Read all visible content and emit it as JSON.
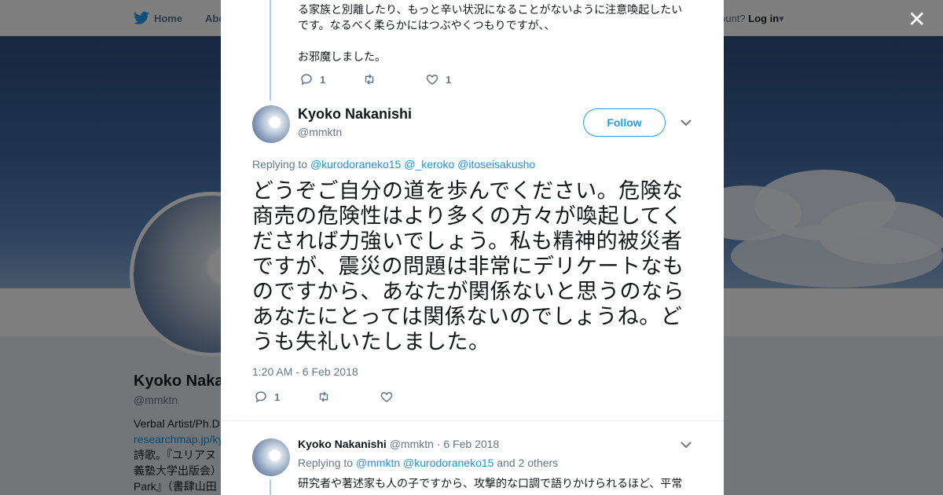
{
  "nav": {
    "home_label": "Home",
    "about_label": "Abo",
    "account_prompt": "ccount?",
    "login_label": "Log in"
  },
  "profile": {
    "name": "Kyoko Naka",
    "handle": "@mmktn",
    "bio_lines": [
      "Verbal Artist/Ph.D",
      "researchmap.jp/ky",
      "詩歌。『ユリアヌ",
      "義塾大学出版会）.",
      "Park』（書肆山田"
    ]
  },
  "prev_tweet": {
    "text_lines": [
      "る家族と別離したり、もっと辛い状況になることがないように注意喚起したい",
      "です。なるべく柔らかにはつぶやくつもりですが、、",
      "",
      "お邪魔しました。"
    ],
    "reply_count": "1",
    "like_count": "1"
  },
  "main_tweet": {
    "name": "Kyoko Nakanishi",
    "handle": "@mmktn",
    "follow_label": "Follow",
    "replying_label": "Replying to",
    "mentions": [
      "@kurodoraneko15",
      "@_keroko",
      "@itoseisakusho"
    ],
    "text": "どうぞご自分の道を歩んでください。危険な商売の危険性はより多くの方々が喚起してくだされば力強いでしょう。私も精神的被災者ですが、震災の問題は非常にデリケートなものですから、あなたが関係ないと思うのならあなたにとっては関係ないのでしょうね。どうも失礼いたしました。",
    "timestamp": "1:20 AM - 6 Feb 2018",
    "reply_count": "1"
  },
  "next_tweet": {
    "name": "Kyoko Nakanishi",
    "handle": "@mmktn",
    "date": "· 6 Feb 2018",
    "replying_label": "Replying to",
    "mentions": [
      "@mmktn",
      "@kurodoraneko15"
    ],
    "others": "and 2 others",
    "text": "研究者や著述家も人の子ですから、攻撃的な口調で語りかけられるほど、平常"
  },
  "colors": {
    "accent": "#1da1f2",
    "thread": "#a5d0f0",
    "muted": "#657786"
  },
  "icons": [
    "twitter-bird-icon",
    "reply-icon",
    "retweet-icon",
    "heart-icon",
    "chevron-down-icon",
    "close-icon"
  ]
}
